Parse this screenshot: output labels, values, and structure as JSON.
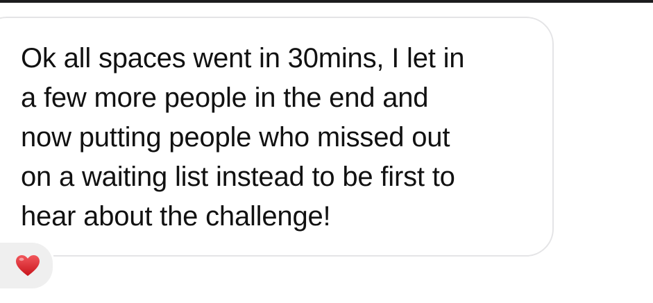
{
  "message": {
    "lines": [
      "Ok all spaces went in 30mins, I let in",
      "a few more people in the end and",
      "now putting people who missed out",
      "on a waiting list instead to be first to",
      "hear about the challenge!"
    ]
  },
  "reaction": {
    "icon": "heart-icon",
    "color": "#e0242b"
  }
}
